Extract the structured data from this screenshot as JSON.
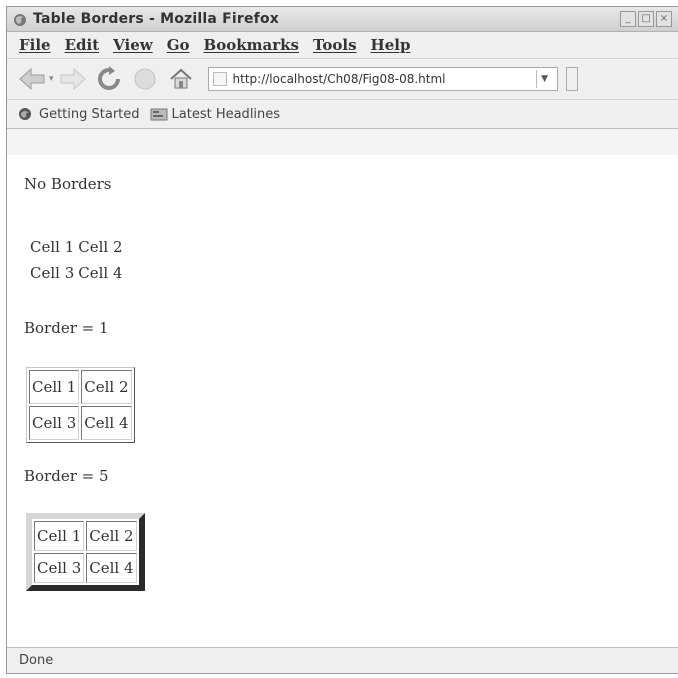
{
  "window": {
    "title": "Table Borders - Mozilla Firefox",
    "buttons": [
      "_",
      "□",
      "×"
    ]
  },
  "menu": [
    "File",
    "Edit",
    "View",
    "Go",
    "Bookmarks",
    "Tools",
    "Help"
  ],
  "toolbar": {
    "icons": [
      "back-icon",
      "forward-icon",
      "reload-icon",
      "stop-icon",
      "home-icon"
    ],
    "url": "http://localhost/Ch08/Fig08-08.html"
  },
  "bookmarks": [
    {
      "label": "Getting Started",
      "icon": "firefox-icon"
    },
    {
      "label": "Latest Headlines",
      "icon": "rss-icon"
    }
  ],
  "content": {
    "heading_none": "No Borders",
    "heading_b1": "Border = 1",
    "heading_b5": "Border = 5",
    "table_none": {
      "cells": [
        [
          "Cell 1",
          "Cell 2"
        ],
        [
          "Cell 3",
          "Cell 4"
        ]
      ]
    },
    "table_b1": {
      "cells": [
        [
          "Cell 1",
          "Cell 2"
        ],
        [
          "Cell 3",
          "Cell 4"
        ]
      ]
    },
    "table_b5": {
      "cells": [
        [
          "Cell 1",
          "Cell 2"
        ],
        [
          "Cell 3",
          "Cell 4"
        ]
      ]
    }
  },
  "status": {
    "text": "Done"
  }
}
